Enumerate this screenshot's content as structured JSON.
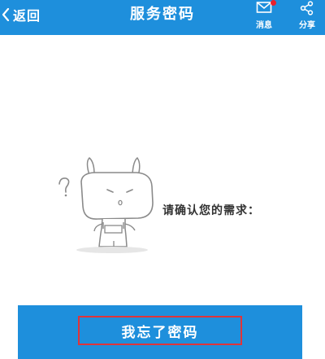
{
  "header": {
    "back_label": "返回",
    "title": "服务密码",
    "message_label": "消息",
    "share_label": "分享",
    "message_badge": true
  },
  "main": {
    "prompt": "请确认您的需求："
  },
  "action": {
    "forgot_password_label": "我忘了密码"
  },
  "colors": {
    "header_bg": "#1e8fdc",
    "button_bg": "#1e8fdc",
    "highlight_border": "#e0343a",
    "badge": "#e8202c"
  },
  "icons": [
    "back-chevron-icon",
    "envelope-icon",
    "share-icon",
    "confused-bunny-mascot"
  ]
}
